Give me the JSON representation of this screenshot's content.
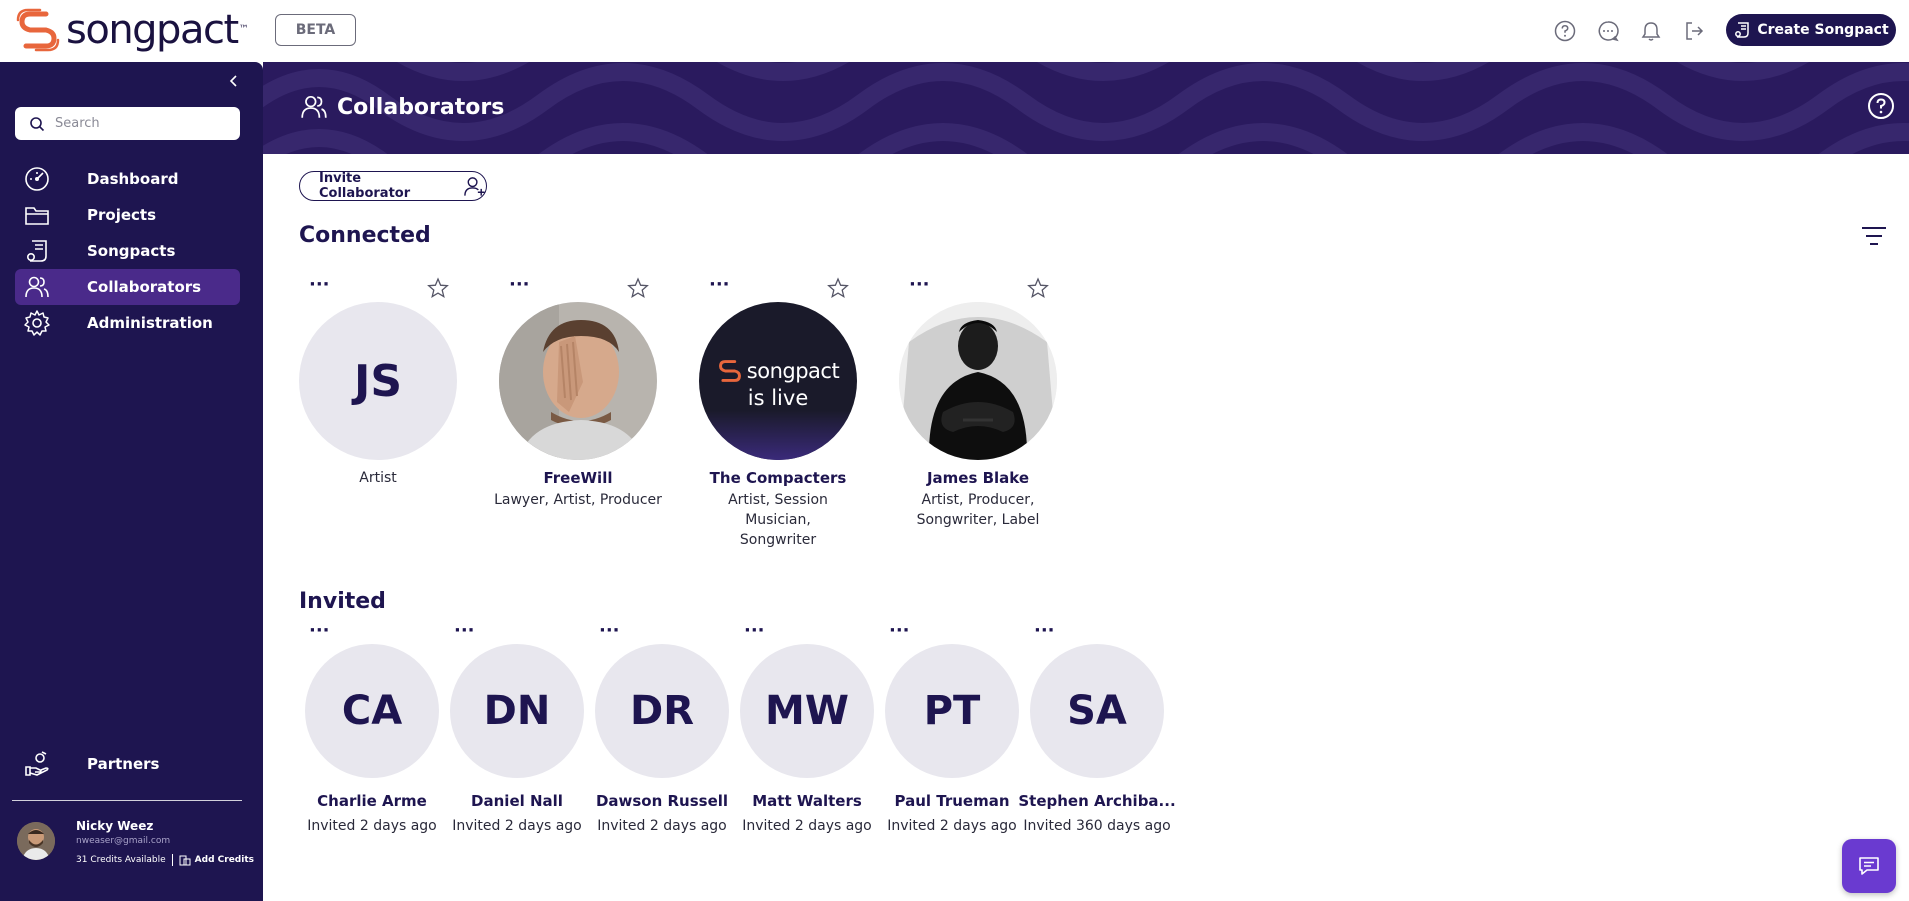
{
  "header": {
    "brand": "songpact",
    "brand_tm": "™",
    "beta_label": "BETA",
    "create_button": "Create Songpact"
  },
  "sidebar": {
    "search_placeholder": "Search",
    "items": [
      {
        "label": "Dashboard",
        "icon": "dashboard-icon"
      },
      {
        "label": "Projects",
        "icon": "folder-icon"
      },
      {
        "label": "Songpacts",
        "icon": "songpact-icon"
      },
      {
        "label": "Collaborators",
        "icon": "users-icon",
        "active": true
      },
      {
        "label": "Administration",
        "icon": "gear-icon"
      }
    ],
    "partners_label": "Partners",
    "user": {
      "name": "Nicky Weez",
      "email": "nweaser@gmail.com",
      "credits": "31 Credits Available",
      "add_credits": "Add Credits"
    }
  },
  "page": {
    "title": "Collaborators",
    "invite_button": "Invite Collaborator",
    "connected_title": "Connected",
    "invited_title": "Invited"
  },
  "connected": [
    {
      "initials": "JS",
      "name": "",
      "roles": "Artist",
      "photo": false
    },
    {
      "initials": "",
      "name": "FreeWill",
      "roles": "Lawyer, Artist, Producer",
      "photo": "man-photo"
    },
    {
      "initials": "",
      "name": "The Compacters",
      "roles": "Artist, Session Musician, Songwriter",
      "photo": "songpact-promo",
      "promo_brand": "songpact",
      "promo_text": "is live"
    },
    {
      "initials": "",
      "name": "James Blake",
      "roles": "Artist, Producer, Songwriter, Label",
      "photo": "bw-photo"
    }
  ],
  "invited": [
    {
      "initials": "CA",
      "name": "Charlie Arme",
      "status": "Invited 2 days ago"
    },
    {
      "initials": "DN",
      "name": "Daniel Nall",
      "status": "Invited 2 days ago"
    },
    {
      "initials": "DR",
      "name": "Dawson Russell",
      "status": "Invited 2 days ago"
    },
    {
      "initials": "MW",
      "name": "Matt Walters",
      "status": "Invited 2 days ago"
    },
    {
      "initials": "PT",
      "name": "Paul Trueman",
      "status": "Invited 2 days ago"
    },
    {
      "initials": "SA",
      "name": "Stephen Archiba...",
      "status": "Invited 360 days ago"
    }
  ],
  "colors": {
    "navy": "#1e1550",
    "active": "#4a2a8a",
    "accent": "#6a3ad0",
    "logo": "#e8663c"
  }
}
